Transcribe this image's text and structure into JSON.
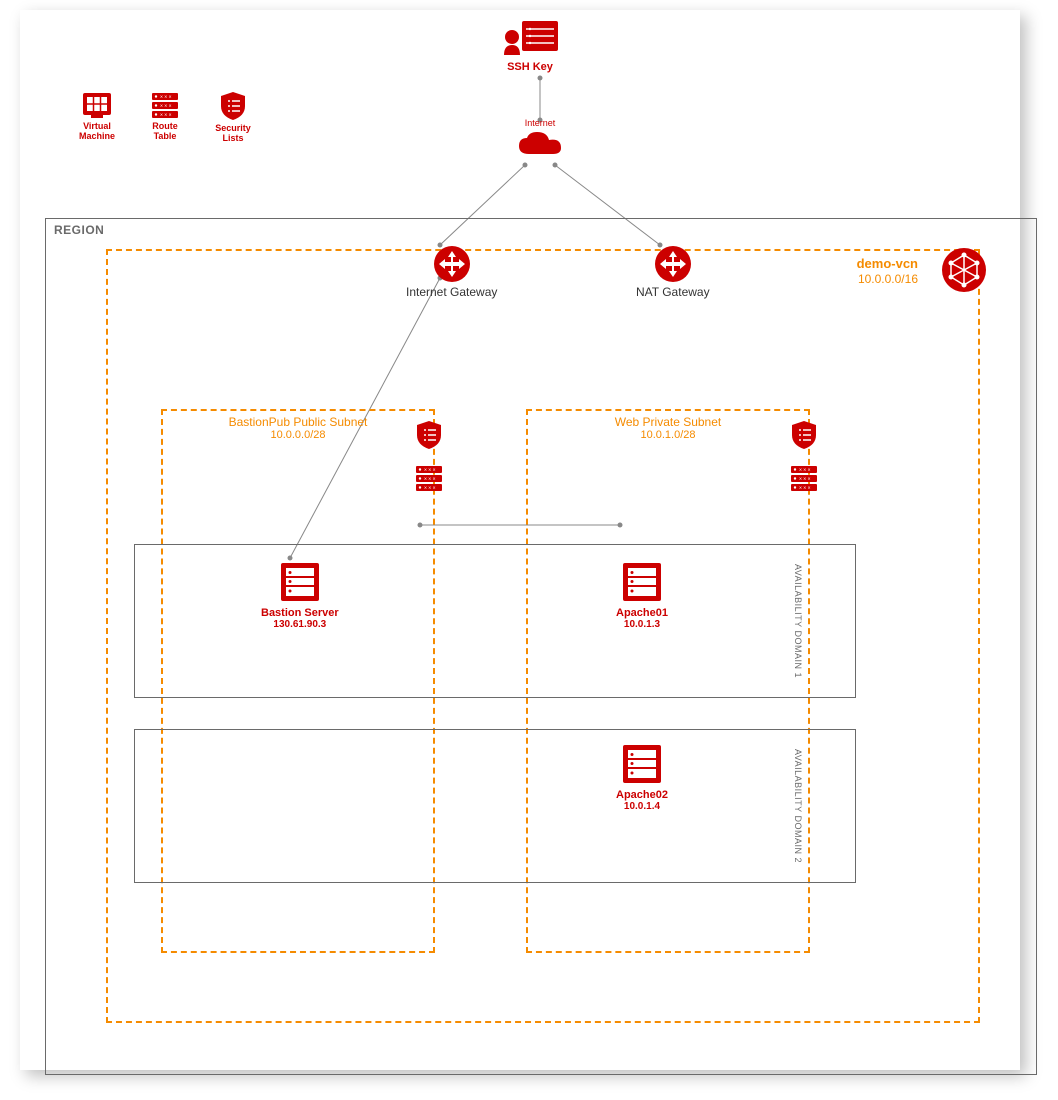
{
  "colors": {
    "red": "#cc0000",
    "orange": "#f58b00",
    "gray": "#6a6a6a"
  },
  "legend": {
    "vm": "Virtual Machine",
    "rt": "Route Table",
    "sl": "Security Lists"
  },
  "ssh": {
    "label": "SSH Key"
  },
  "internet": {
    "label": "Internet"
  },
  "region": {
    "label": "REGION"
  },
  "vcn": {
    "name": "demo-vcn",
    "cidr": "10.0.0.0/16"
  },
  "igw": {
    "label": "Internet Gateway"
  },
  "natgw": {
    "label": "NAT Gateway"
  },
  "subnet_pub": {
    "title": "BastionPub Public Subnet",
    "cidr": "10.0.0.0/28"
  },
  "subnet_web": {
    "title": "Web Private Subnet",
    "cidr": "10.0.1.0/28"
  },
  "ad1": {
    "label": "AVAILABILITY DOMAIN 1"
  },
  "ad2": {
    "label": "AVAILABILITY DOMAIN 2"
  },
  "bastion": {
    "name": "Bastion Server",
    "ip": "130.61.90.3"
  },
  "apache01": {
    "name": "Apache01",
    "ip": "10.0.1.3"
  },
  "apache02": {
    "name": "Apache02",
    "ip": "10.0.1.4"
  }
}
